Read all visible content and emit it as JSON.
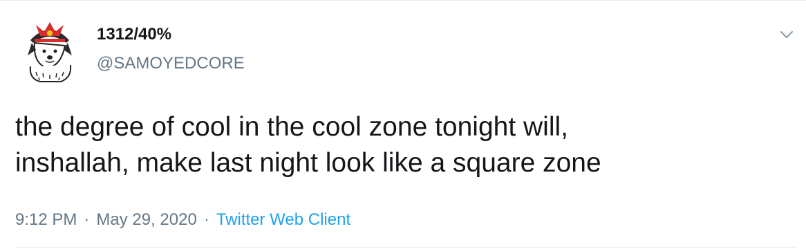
{
  "user": {
    "display_name": "1312/40%",
    "handle": "@SAMOYEDCORE",
    "avatar_icon": "samoyed-with-samurai-helmet"
  },
  "tweet": {
    "lines": [
      "the degree of cool in the cool zone tonight will,",
      "inshallah, make last night look like a square zone"
    ]
  },
  "meta": {
    "time": "9:12 PM",
    "date": "May 29, 2020",
    "separator": "·",
    "source": "Twitter Web Client"
  },
  "colors": {
    "text": "#14171a",
    "secondary": "#657786",
    "link": "#1da1f2",
    "border": "#e6ecf0"
  },
  "icons": {
    "menu": "chevron-down-icon"
  }
}
